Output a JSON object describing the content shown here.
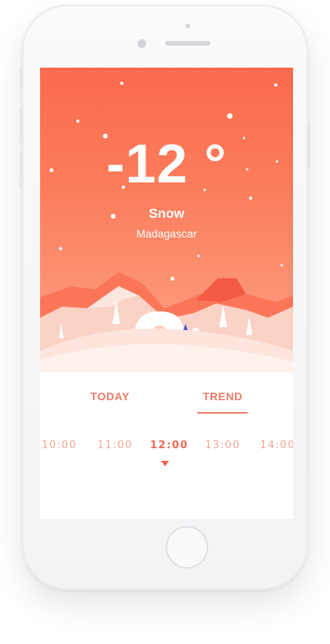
{
  "weather": {
    "temperature": "-12 °",
    "condition": "Snow",
    "location": "Madagascar"
  },
  "tabs": [
    {
      "label": "TODAY",
      "active": false
    },
    {
      "label": "TREND",
      "active": true
    }
  ],
  "timeline": [
    {
      "label": "10:00",
      "active": false
    },
    {
      "label": "11:00",
      "active": false
    },
    {
      "label": "12:00",
      "active": true
    },
    {
      "label": "13:00",
      "active": false
    },
    {
      "label": "14:00",
      "active": false
    }
  ],
  "colors": {
    "hero_top": "#fb6a4f",
    "hero_bottom": "#fca486",
    "accent": "#ef7a68",
    "timeline_inactive": "#f3a596",
    "indicator": "#f2614a"
  }
}
